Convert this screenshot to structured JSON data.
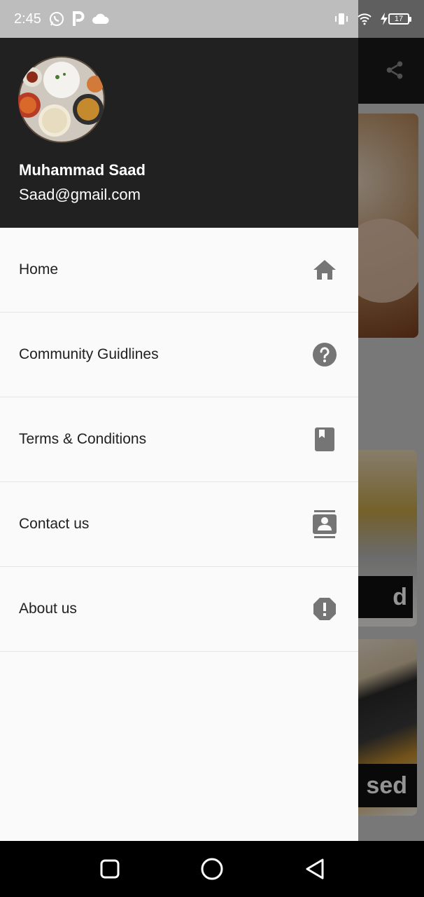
{
  "status_bar": {
    "time": "2:45",
    "battery_level": "17"
  },
  "drawer": {
    "user": {
      "name": "Muhammad Saad",
      "email": "Saad@gmail.com"
    },
    "items": [
      {
        "label": "Home",
        "icon": "home-icon"
      },
      {
        "label": "Community Guidlines",
        "icon": "help-circle-icon"
      },
      {
        "label": "Terms & Conditions",
        "icon": "book-icon"
      },
      {
        "label": "Contact us",
        "icon": "contact-card-icon"
      },
      {
        "label": "About us",
        "icon": "alert-octagon-icon"
      }
    ]
  },
  "background": {
    "card2_label": "d",
    "card3_label": "sed"
  },
  "colors": {
    "drawer_header": "#212121",
    "drawer_bg": "#fafafa",
    "icon_gray": "#757575",
    "nav_bar": "#000000"
  }
}
